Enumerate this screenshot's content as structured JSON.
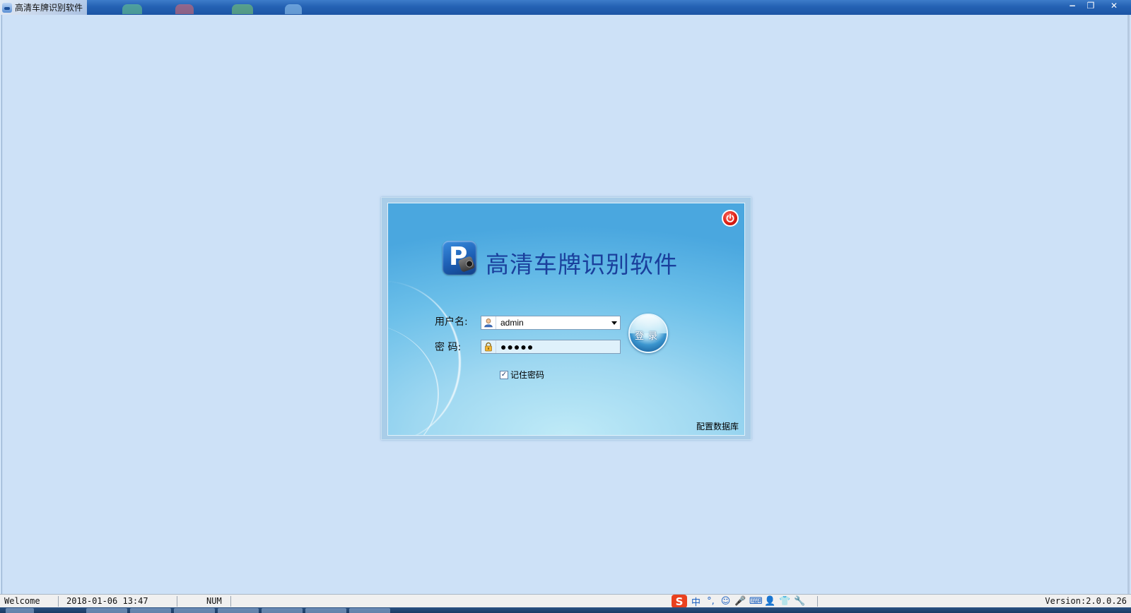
{
  "window": {
    "title": "高清车牌识别软件",
    "controls": {
      "minimize": "−",
      "restore": "❐",
      "close": "✕"
    }
  },
  "login": {
    "app_title": "高清车牌识别软件",
    "logo_letter": "P",
    "username_label": "用户名:",
    "username_value": "admin",
    "password_label": "密    码:",
    "password_value": "●●●●●",
    "login_button": "登录",
    "remember_checked": true,
    "remember_label": "记住密码",
    "config_link": "配置数据库"
  },
  "statusbar": {
    "welcome": "Welcome",
    "datetime": "2018-01-06 13:47",
    "num": "NUM",
    "version": "Version:2.0.0.26",
    "ime": {
      "logo": "S",
      "mode": "中",
      "punct": "°,",
      "emoji": "☺",
      "voice": "🎤",
      "keyboard": "⌨",
      "user": "👤",
      "skin": "👕",
      "tools": "🔧"
    }
  },
  "colors": {
    "titlebar": "#2461b3",
    "client_bg": "#cde1f7",
    "title_text": "#1a3f9c",
    "power_red": "#d81c12"
  }
}
